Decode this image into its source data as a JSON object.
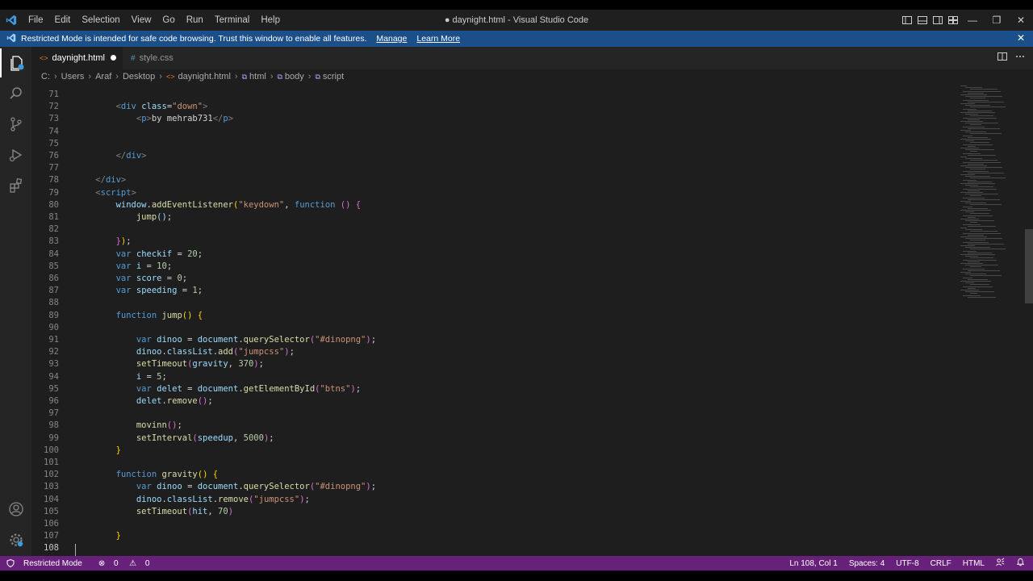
{
  "window": {
    "title": "● daynight.html - Visual Studio Code",
    "menu": [
      "File",
      "Edit",
      "Selection",
      "View",
      "Go",
      "Run",
      "Terminal",
      "Help"
    ],
    "controls": {
      "minimize": "—",
      "maximize": "❐",
      "close": "✕"
    }
  },
  "banner": {
    "text": "Restricted Mode is intended for safe code browsing. Trust this window to enable all features.",
    "manage": "Manage",
    "learn_more": "Learn More",
    "close": "✕"
  },
  "tabs": [
    {
      "icon": "<>",
      "label": "daynight.html",
      "active": true,
      "dirty": true
    },
    {
      "icon": "#",
      "label": "style.css",
      "active": false,
      "dirty": false
    }
  ],
  "breadcrumb": [
    "C:",
    "Users",
    "Araf",
    "Desktop",
    "daynight.html",
    "html",
    "body",
    "script"
  ],
  "editor": {
    "lines": [
      {
        "n": "71",
        "html": ""
      },
      {
        "n": "72",
        "html": "        <span class='br'>&lt;</span><span class='tg'>div</span> <span class='vr'>class</span>=<span class='st'>\"down\"</span><span class='br'>&gt;</span>"
      },
      {
        "n": "73",
        "html": "            <span class='br'>&lt;</span><span class='tg'>p</span><span class='br'>&gt;</span>by mehrab731<span class='br'>&lt;/</span><span class='tg'>p</span><span class='br'>&gt;</span>"
      },
      {
        "n": "74",
        "html": ""
      },
      {
        "n": "75",
        "html": ""
      },
      {
        "n": "76",
        "html": "        <span class='br'>&lt;/</span><span class='tg'>div</span><span class='br'>&gt;</span>"
      },
      {
        "n": "77",
        "html": ""
      },
      {
        "n": "78",
        "html": "    <span class='br'>&lt;/</span><span class='tg'>div</span><span class='br'>&gt;</span>"
      },
      {
        "n": "79",
        "html": "    <span class='br'>&lt;</span><span class='tg'>script</span><span class='br'>&gt;</span>"
      },
      {
        "n": "80",
        "html": "        <span class='vr'>window</span>.<span class='fn'>addEventListener</span><span class='pn'>(</span><span class='st'>\"keydown\"</span>, <span class='kw'>function</span> <span class='pp'>()</span> <span class='pp'>{</span>"
      },
      {
        "n": "81",
        "html": "            <span class='fn'>jump</span><span class='vr'>()</span>;"
      },
      {
        "n": "82",
        "html": ""
      },
      {
        "n": "83",
        "html": "        <span class='pp'>}</span><span class='pn'>)</span>;"
      },
      {
        "n": "84",
        "html": "        <span class='kw'>var</span> <span class='vr'>checkif</span> = <span class='nm'>20</span>;"
      },
      {
        "n": "85",
        "html": "        <span class='kw'>var</span> <span class='vr'>i</span> = <span class='nm'>10</span>;"
      },
      {
        "n": "86",
        "html": "        <span class='kw'>var</span> <span class='vr'>score</span> = <span class='nm'>0</span>;"
      },
      {
        "n": "87",
        "html": "        <span class='kw'>var</span> <span class='vr'>speeding</span> = <span class='nm'>1</span>;"
      },
      {
        "n": "88",
        "html": ""
      },
      {
        "n": "89",
        "html": "        <span class='kw'>function</span> <span class='fn'>jump</span><span class='pn'>()</span> <span class='pn'>{</span>"
      },
      {
        "n": "90",
        "html": ""
      },
      {
        "n": "91",
        "html": "            <span class='kw'>var</span> <span class='vr'>dinoo</span> = <span class='vr'>document</span>.<span class='fn'>querySelector</span><span class='pp'>(</span><span class='st'>\"#dinopng\"</span><span class='pp'>)</span>;"
      },
      {
        "n": "92",
        "html": "            <span class='vr'>dinoo</span>.<span class='vr'>classList</span>.<span class='fn'>add</span><span class='pp'>(</span><span class='st'>\"jumpcss\"</span><span class='pp'>)</span>;"
      },
      {
        "n": "93",
        "html": "            <span class='fn'>setTimeout</span><span class='pp'>(</span><span class='vr'>gravity</span>, <span class='nm'>370</span><span class='pp'>)</span>;"
      },
      {
        "n": "94",
        "html": "            <span class='vr'>i</span> = <span class='nm'>5</span>;"
      },
      {
        "n": "95",
        "html": "            <span class='kw'>var</span> <span class='vr'>delet</span> = <span class='vr'>document</span>.<span class='fn'>getElementById</span><span class='pp'>(</span><span class='st'>\"btns\"</span><span class='pp'>)</span>;"
      },
      {
        "n": "96",
        "html": "            <span class='vr'>delet</span>.<span class='fn'>remove</span><span class='pp'>()</span>;"
      },
      {
        "n": "97",
        "html": ""
      },
      {
        "n": "98",
        "html": "            <span class='fn'>movinn</span><span class='pp'>()</span>;"
      },
      {
        "n": "99",
        "html": "            <span class='fn'>setInterval</span><span class='pp'>(</span><span class='vr'>speedup</span>, <span class='nm'>5000</span><span class='pp'>)</span>;"
      },
      {
        "n": "100",
        "html": "        <span class='pn'>}</span>"
      },
      {
        "n": "101",
        "html": ""
      },
      {
        "n": "102",
        "html": "        <span class='kw'>function</span> <span class='fn'>gravity</span><span class='pn'>()</span> <span class='pn'>{</span>"
      },
      {
        "n": "103",
        "html": "            <span class='kw'>var</span> <span class='vr'>dinoo</span> = <span class='vr'>document</span>.<span class='fn'>querySelector</span><span class='pp'>(</span><span class='st'>\"#dinopng\"</span><span class='pp'>)</span>;"
      },
      {
        "n": "104",
        "html": "            <span class='vr'>dinoo</span>.<span class='vr'>classList</span>.<span class='fn'>remove</span><span class='pp'>(</span><span class='st'>\"jumpcss\"</span><span class='pp'>)</span>;"
      },
      {
        "n": "105",
        "html": "            <span class='fn'>setTimeout</span><span class='pp'>(</span><span class='vr'>hit</span>, <span class='nm'>70</span><span class='pp'>)</span>"
      },
      {
        "n": "106",
        "html": ""
      },
      {
        "n": "107",
        "html": "        <span class='pn'>}</span>"
      },
      {
        "n": "108",
        "html": ""
      }
    ]
  },
  "statusbar": {
    "mode": "Restricted Mode",
    "errors": "0",
    "warnings": "0",
    "position": "Ln 108, Col 1",
    "spaces": "Spaces: 4",
    "encoding": "UTF-8",
    "eol": "CRLF",
    "language": "HTML"
  },
  "colors": {
    "banner": "#1b4f8a",
    "statusbar": "#68217a",
    "editor_bg": "#1e1e1e",
    "vscode_blue": "#3b9ae0"
  }
}
